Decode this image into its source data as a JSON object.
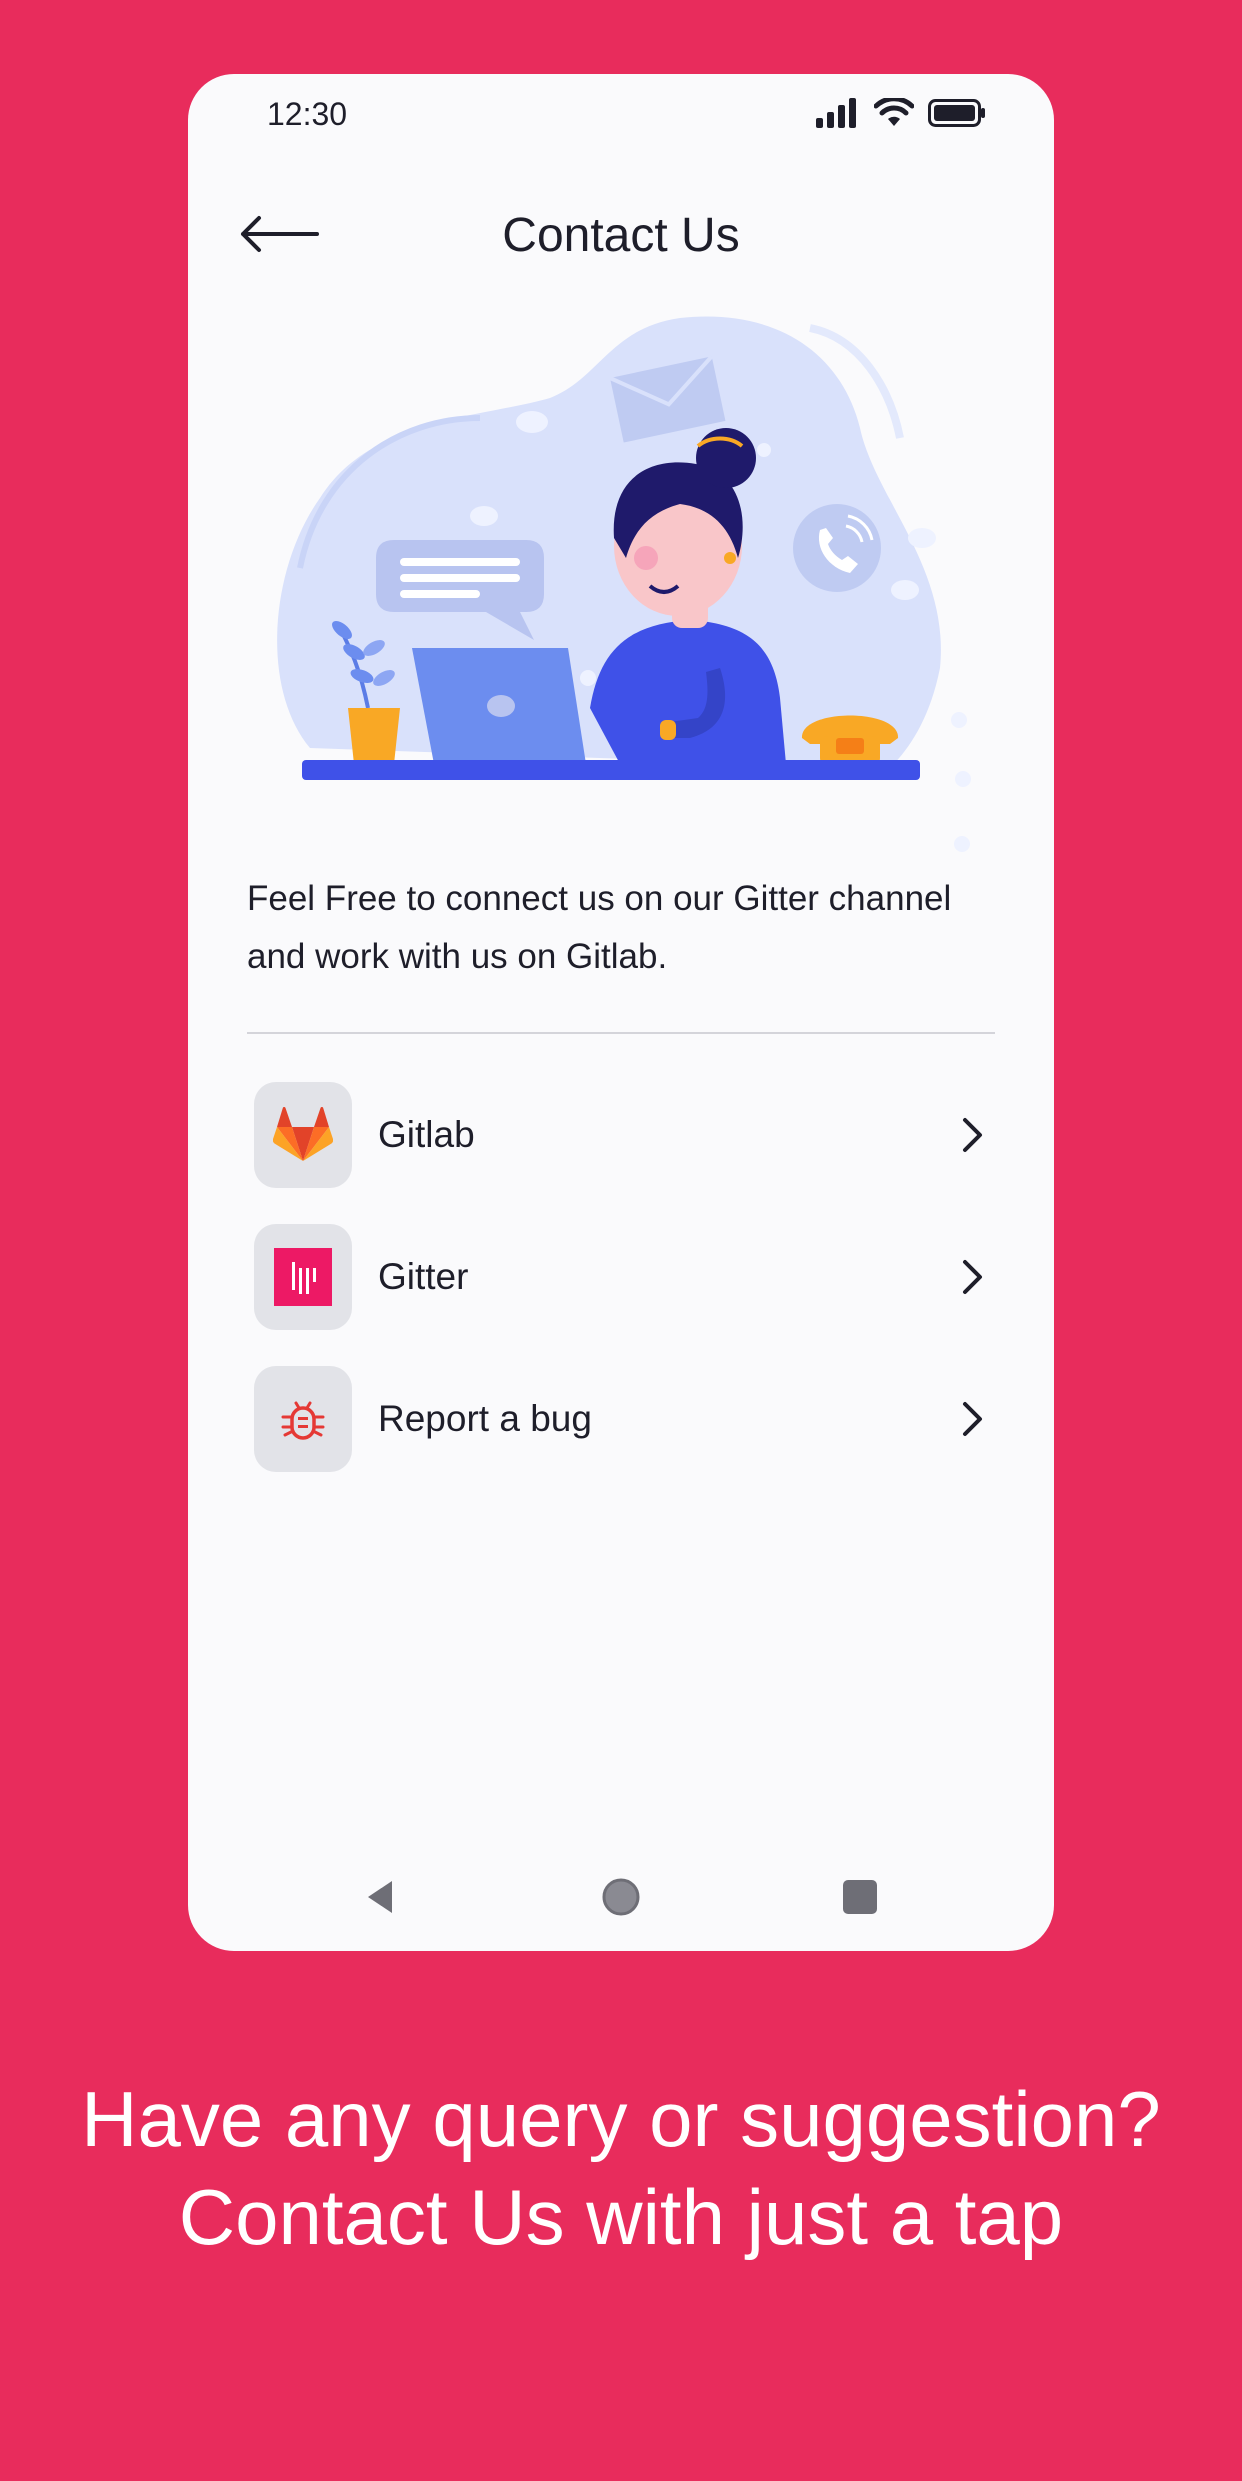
{
  "status_bar": {
    "time": "12:30",
    "icons": [
      "signal-icon",
      "wifi-icon",
      "battery-icon"
    ]
  },
  "header": {
    "title": "Contact Us",
    "back_icon": "arrow-left-icon"
  },
  "description": "Feel Free to connect us on our Gitter channel and work with us on Gitlab.",
  "menu": {
    "items": [
      {
        "label": "Gitlab",
        "icon": "gitlab-logo-icon"
      },
      {
        "label": "Gitter",
        "icon": "gitter-logo-icon"
      },
      {
        "label": "Report a bug",
        "icon": "bug-icon"
      }
    ]
  },
  "tagline": "Have any query or suggestion? Contact Us with just a tap",
  "colors": {
    "background": "#E82C5C",
    "phone_screen": "#FAFAFC",
    "accent_blue": "#3F51E8",
    "gitter_pink": "#ED1965"
  }
}
